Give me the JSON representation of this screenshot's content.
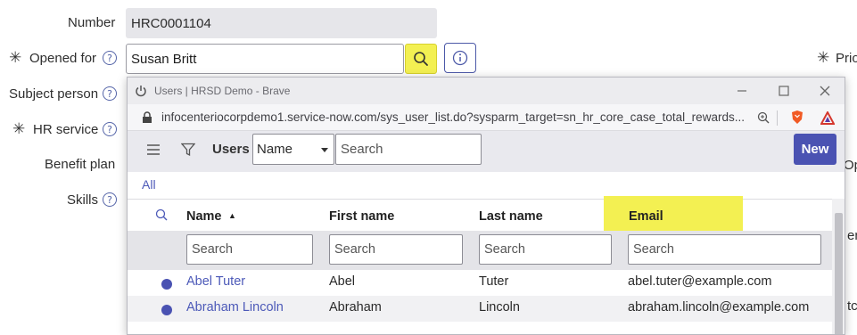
{
  "form": {
    "number_label": "Number",
    "number_value": "HRC0001104",
    "opened_for_label": "Opened for",
    "opened_for_value": "Susan Britt",
    "subject_person_label": "Subject person",
    "hr_service_label": "HR service",
    "benefit_plan_label": "Benefit plan",
    "skills_label": "Skills",
    "priority_label_partial": "Prio",
    "required_mark": "✳",
    "help_mark": "?",
    "right_edge_fragments": [
      "Ope",
      "ene",
      "tch"
    ]
  },
  "popup": {
    "title": "Users | HRSD Demo - Brave",
    "url": "infocenteriocorpdemo1.service-now.com/sys_user_list.do?sysparm_target=sn_hr_core_case_total_rewards...",
    "list_title": "Users",
    "search_field_select": "Name",
    "search_placeholder": "Search",
    "new_button": "New",
    "breadcrumb_all": "All",
    "columns": [
      "Name",
      "First name",
      "Last name",
      "Email"
    ],
    "sort_indicator": "▲",
    "column_search_placeholder": "Search",
    "rows": [
      {
        "name": "Abel Tuter",
        "first": "Abel",
        "last": "Tuter",
        "email": "abel.tuter@example.com"
      },
      {
        "name": "Abraham Lincoln",
        "first": "Abraham",
        "last": "Lincoln",
        "email": "abraham.lincoln@example.com"
      }
    ]
  },
  "colors": {
    "highlight": "#f3f052",
    "link": "#4c59b8",
    "new_button": "#4a52b2"
  }
}
